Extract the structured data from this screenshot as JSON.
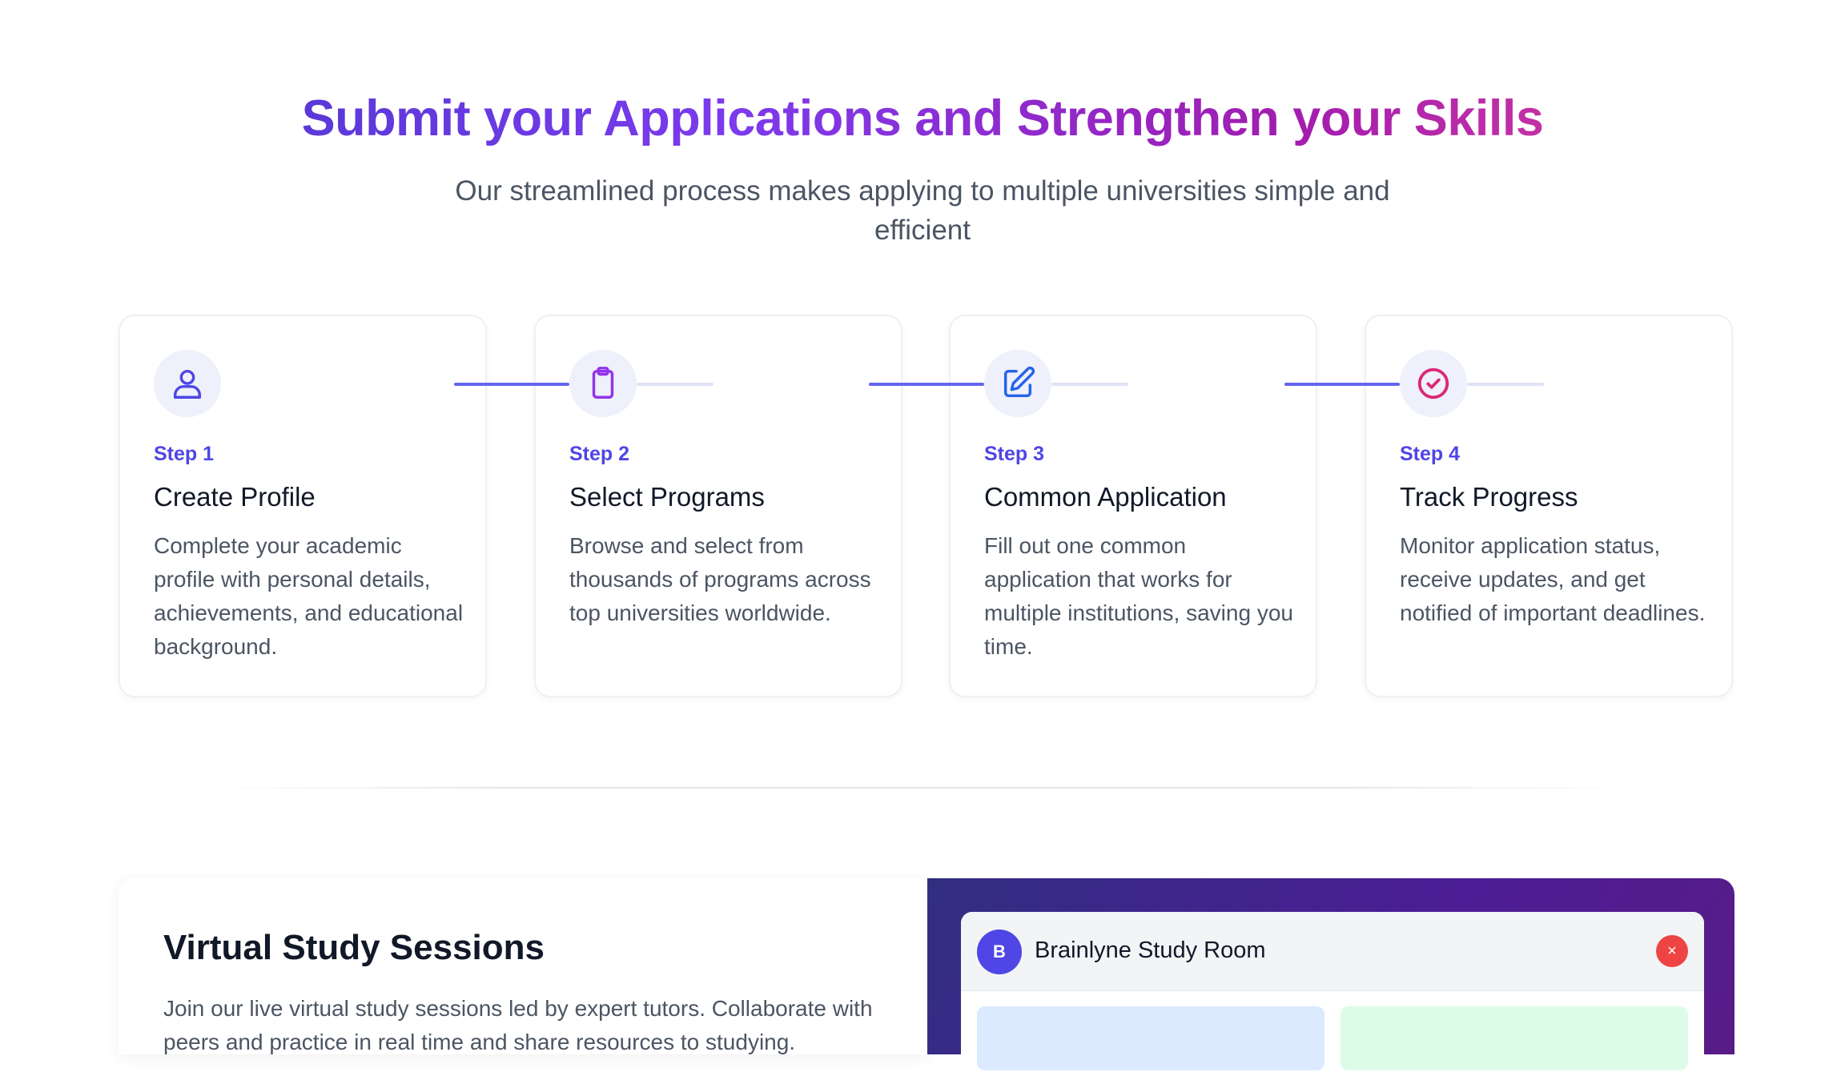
{
  "hero": {
    "title": "Submit your Applications and Strengthen your Skills",
    "subtitle": "Our streamlined process makes applying to multiple universities simple and efficient"
  },
  "steps": [
    {
      "num": "Step 1",
      "title": "Create Profile",
      "desc": "Complete your academic profile with personal details, achievements, and educational background.",
      "icon": "user-icon",
      "color": "#4f46e5"
    },
    {
      "num": "Step 2",
      "title": "Select Programs",
      "desc": "Browse and select from thousands of programs across top universities worldwide.",
      "icon": "clipboard-icon",
      "color": "#9333ea"
    },
    {
      "num": "Step 3",
      "title": "Common Application",
      "desc": "Fill out one common application that works for multiple institutions, saving you time.",
      "icon": "edit-icon",
      "color": "#2563eb"
    },
    {
      "num": "Step 4",
      "title": "Track Progress",
      "desc": "Monitor application status, receive updates, and get notified of important deadlines.",
      "icon": "check-circle-icon",
      "color": "#db2777"
    }
  ],
  "virtual": {
    "title": "Virtual Study Sessions",
    "desc": "Join our live virtual study sessions led by expert tutors. Collaborate with peers and practice in real time and share resources to studying."
  },
  "room": {
    "avatar": "B",
    "name": "Brainlyne Study Room",
    "close": "×"
  }
}
